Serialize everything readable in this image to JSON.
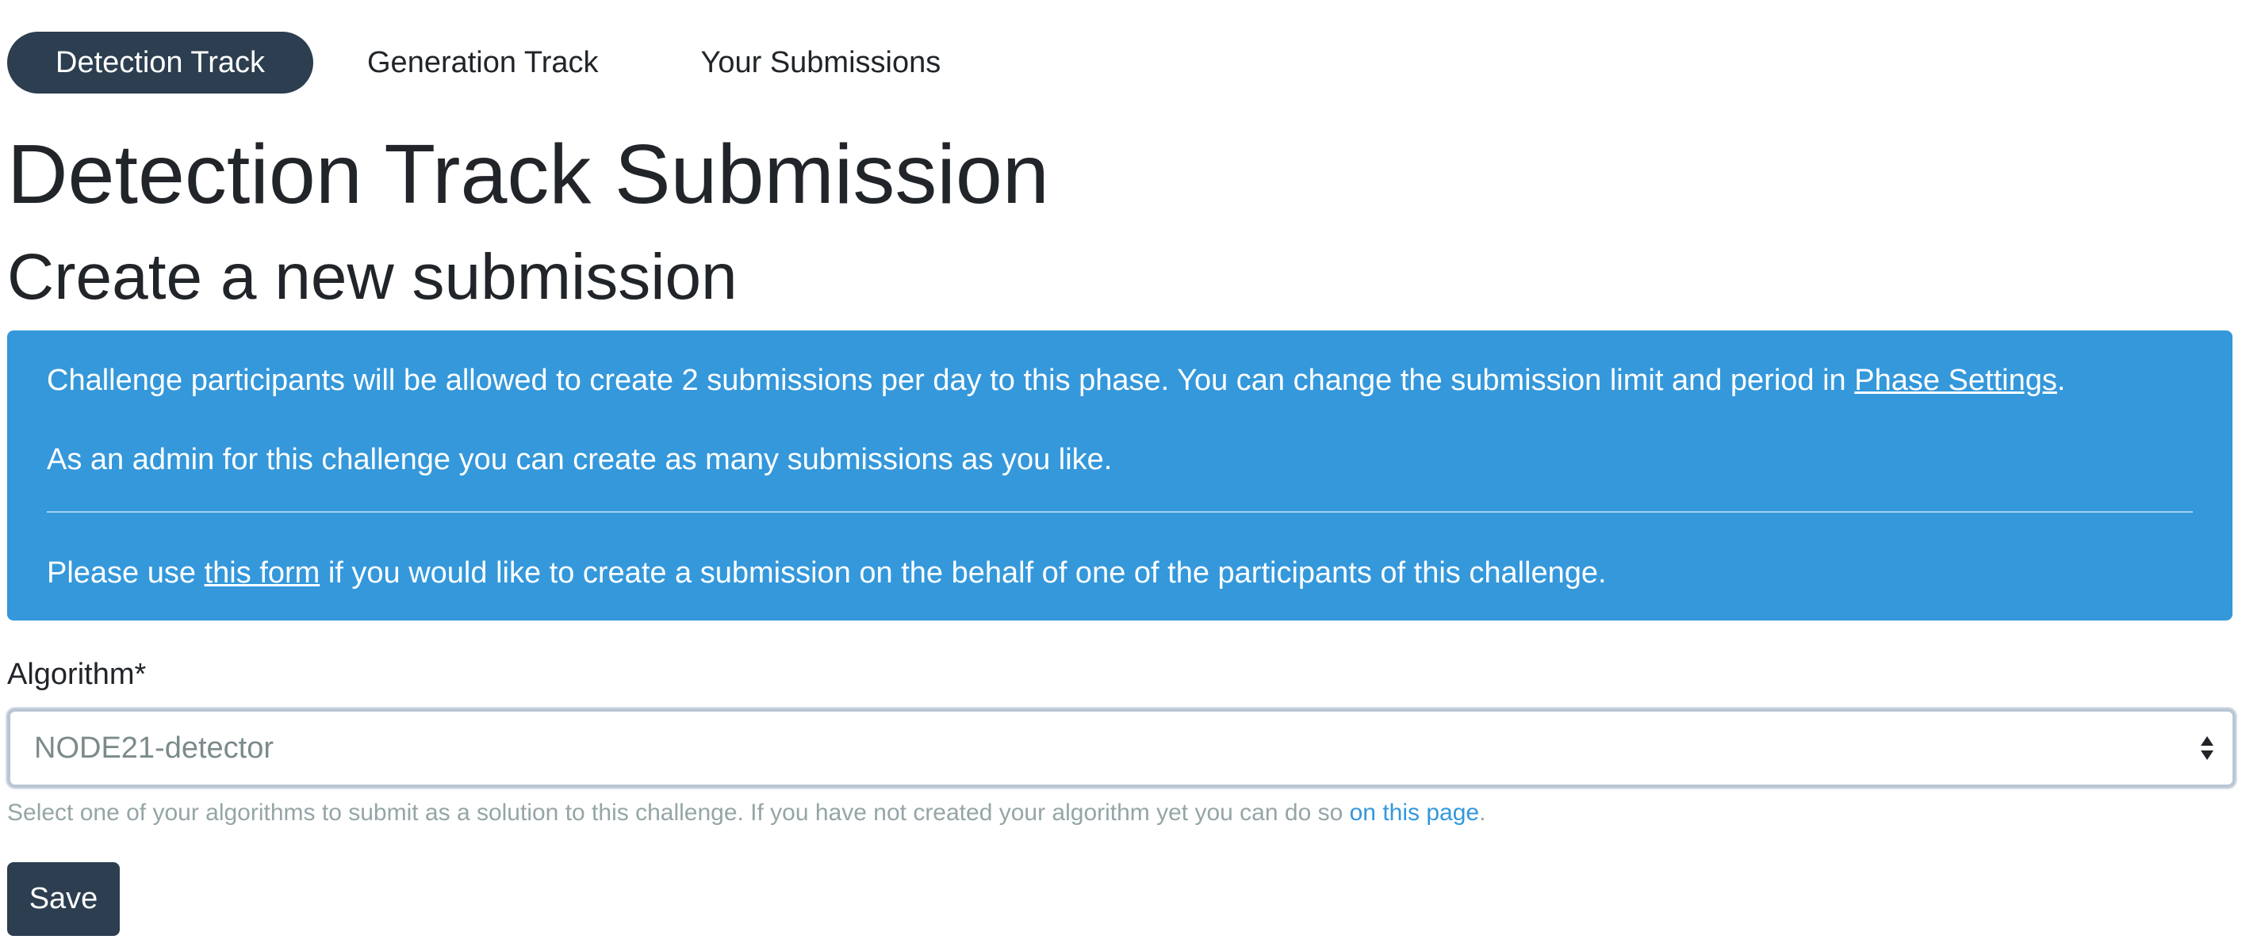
{
  "tabs": [
    {
      "label": "Detection Track",
      "active": true
    },
    {
      "label": "Generation Track",
      "active": false
    },
    {
      "label": "Your Submissions",
      "active": false
    }
  ],
  "page_title": "Detection Track Submission",
  "subtitle": "Create a new submission",
  "alert": {
    "line1_prefix": "Challenge participants will be allowed to create 2 submissions per day to this phase. You can change the submission limit and period in ",
    "line1_link": "Phase Settings",
    "line1_suffix": ".",
    "line2": "As an admin for this challenge you can create as many submissions as you like.",
    "line3_prefix": "Please use ",
    "line3_link": "this form",
    "line3_suffix": " if you would like to create a submission on the behalf of one of the participants of this challenge."
  },
  "form": {
    "algorithm_label": "Algorithm*",
    "algorithm_value": "NODE21-detector",
    "help_prefix": "Select one of your algorithms to submit as a solution to this challenge. If you have not created your algorithm yet you can do so ",
    "help_link": "on this page",
    "help_suffix": ".",
    "save_label": "Save"
  },
  "colors": {
    "primary": "#2c3e50",
    "info": "#3498db",
    "muted": "#95a5a6"
  }
}
